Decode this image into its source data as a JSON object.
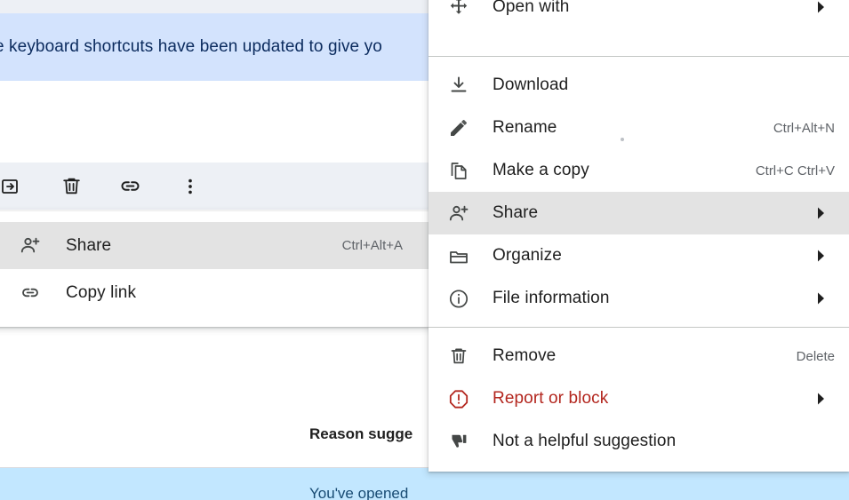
{
  "app": {
    "banner": {
      "text": "e keyboard shortcuts have been updated to give yo"
    },
    "toolbar": {
      "items": [
        {
          "name": "move-to-icon",
          "label": "Move to"
        },
        {
          "name": "trash-icon",
          "label": "Remove"
        },
        {
          "name": "link-icon",
          "label": "Copy link"
        },
        {
          "name": "more-vert-icon",
          "label": "More actions"
        }
      ]
    },
    "details": {
      "reason_heading": "Reason sugge",
      "footer_text": "You've opened"
    }
  },
  "share_submenu": {
    "name": "share-submenu",
    "items": [
      {
        "label": "Share",
        "shortcut": "Ctrl+Alt+A",
        "icon": "person-add-icon",
        "highlighted": true,
        "submenu": false
      },
      {
        "label": "Copy link",
        "shortcut": "",
        "icon": "link-icon",
        "highlighted": false,
        "submenu": false
      }
    ]
  },
  "context_menu": {
    "name": "file-context-menu",
    "groups": [
      {
        "items": [
          {
            "label": "Open with",
            "shortcut": "",
            "icon": "open-with-icon",
            "submenu": true,
            "highlighted": false,
            "danger": false
          }
        ]
      },
      {
        "items": [
          {
            "label": "Download",
            "shortcut": "",
            "icon": "download-icon",
            "submenu": false,
            "highlighted": false,
            "danger": false
          },
          {
            "label": "Rename",
            "shortcut": "Ctrl+Alt+N",
            "icon": "pencil-icon",
            "submenu": false,
            "highlighted": false,
            "danger": false
          },
          {
            "label": "Make a copy",
            "shortcut": "Ctrl+C Ctrl+V",
            "icon": "copy-icon",
            "submenu": false,
            "highlighted": false,
            "danger": false
          },
          {
            "label": "Share",
            "shortcut": "",
            "icon": "person-add-icon",
            "submenu": true,
            "highlighted": true,
            "danger": false
          },
          {
            "label": "Organize",
            "shortcut": "",
            "icon": "folder-icon",
            "submenu": true,
            "highlighted": false,
            "danger": false
          },
          {
            "label": "File information",
            "shortcut": "",
            "icon": "info-icon",
            "submenu": true,
            "highlighted": false,
            "danger": false
          }
        ]
      },
      {
        "items": [
          {
            "label": "Remove",
            "shortcut": "Delete",
            "icon": "trash-icon",
            "submenu": false,
            "highlighted": false,
            "danger": false
          },
          {
            "label": "Report or block",
            "shortcut": "",
            "icon": "report-icon",
            "submenu": true,
            "highlighted": false,
            "danger": true
          },
          {
            "label": "Not a helpful suggestion",
            "shortcut": "",
            "icon": "thumb-down-icon",
            "submenu": false,
            "highlighted": false,
            "danger": false
          }
        ]
      }
    ]
  },
  "colors": {
    "banner_bg": "#d3e3fd",
    "banner_text": "#0b2b5e",
    "toolbar_bg": "#edf0f5",
    "footer_bg": "#c2e7ff",
    "menu_bg": "#ffffff",
    "menu_highlight": "#e3e3e3",
    "danger": "#b3261e",
    "separator": "#c4c7c5"
  }
}
